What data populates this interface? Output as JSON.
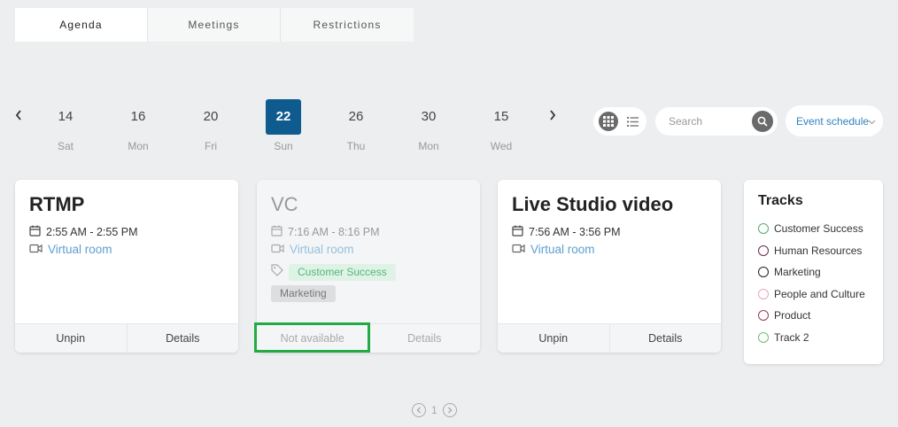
{
  "tabs": [
    {
      "label": "Agenda",
      "active": true
    },
    {
      "label": "Meetings",
      "active": false
    },
    {
      "label": "Restrictions",
      "active": false
    }
  ],
  "dates": [
    {
      "day": "14",
      "weekday": "Sat"
    },
    {
      "day": "16",
      "weekday": "Mon"
    },
    {
      "day": "20",
      "weekday": "Fri"
    },
    {
      "day": "22",
      "weekday": "Sun",
      "selected": true
    },
    {
      "day": "26",
      "weekday": "Thu"
    },
    {
      "day": "30",
      "weekday": "Mon"
    },
    {
      "day": "15",
      "weekday": "Wed"
    }
  ],
  "search": {
    "placeholder": "Search"
  },
  "schedule_select": {
    "value": "Event schedule"
  },
  "cards": [
    {
      "title": "RTMP",
      "time": "2:55 AM - 2:55 PM",
      "room": "Virtual room",
      "primary_action": "Unpin",
      "secondary_action": "Details",
      "available": true
    },
    {
      "title": "VC",
      "time": "7:16 AM - 8:16 PM",
      "room": "Virtual room",
      "tags": [
        "Customer Success",
        "Marketing"
      ],
      "primary_action": "Not available",
      "secondary_action": "Details",
      "available": false
    },
    {
      "title": "Live Studio video",
      "time": "7:56 AM - 3:56 PM",
      "room": "Virtual room",
      "primary_action": "Unpin",
      "secondary_action": "Details",
      "available": true
    }
  ],
  "tracks": {
    "title": "Tracks",
    "items": [
      {
        "label": "Customer Success",
        "color": "#4cae6b"
      },
      {
        "label": "Human Resources",
        "color": "#6b2a4a"
      },
      {
        "label": "Marketing",
        "color": "#222222"
      },
      {
        "label": "People and Culture",
        "color": "#e8a8b8"
      },
      {
        "label": "Product",
        "color": "#9a3a5a"
      },
      {
        "label": "Track 2",
        "color": "#6cc06c"
      }
    ]
  },
  "pagination": {
    "page": "1"
  },
  "colors": {
    "accent": "#0f5a8f",
    "link": "#5c9fd0",
    "highlight": "#22aa44"
  }
}
